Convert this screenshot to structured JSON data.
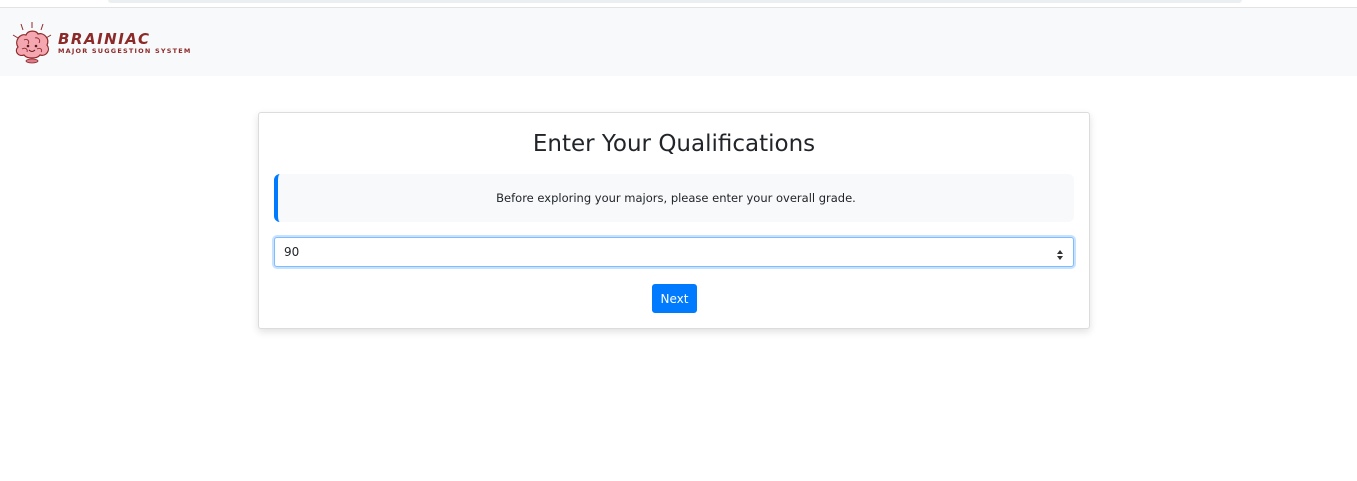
{
  "brand": {
    "name": "BRAINIAC",
    "tagline": "MAJOR SUGGESTION SYSTEM",
    "logo_icon": "brain-icon",
    "color": "#8c2a2a"
  },
  "card": {
    "title": "Enter Your Qualifications",
    "info_message": "Before exploring your majors, please enter your overall grade.",
    "grade_input": {
      "value": "90",
      "type": "number"
    },
    "next_label": "Next"
  },
  "colors": {
    "primary": "#007bff",
    "navbar_bg": "#f8f9fa",
    "info_bg": "#f8f9fa"
  }
}
